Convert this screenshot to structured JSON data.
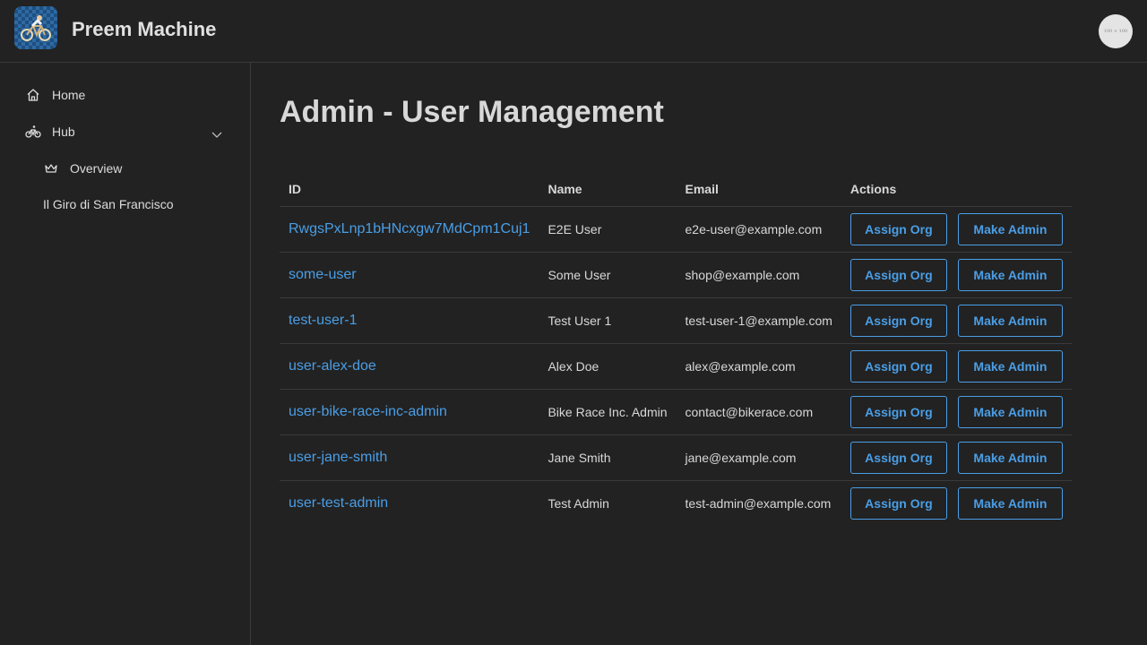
{
  "header": {
    "app_title": "Preem Machine",
    "avatar_text": "100 × 100"
  },
  "sidebar": {
    "items": [
      {
        "label": "Home",
        "icon": "home-icon"
      },
      {
        "label": "Hub",
        "icon": "bike-icon",
        "expanded": true
      },
      {
        "label": "Overview",
        "icon": "crown-icon"
      },
      {
        "label": "Il Giro di San Francisco"
      }
    ]
  },
  "main": {
    "title": "Admin - User Management",
    "table": {
      "columns": [
        "ID",
        "Name",
        "Email",
        "Actions"
      ],
      "assign_label": "Assign Org",
      "admin_label": "Make Admin",
      "rows": [
        {
          "id": "RwgsPxLnp1bHNcxgw7MdCpm1Cuj1",
          "name": "E2E User",
          "email": "e2e-user@example.com"
        },
        {
          "id": "some-user",
          "name": "Some User",
          "email": "shop@example.com"
        },
        {
          "id": "test-user-1",
          "name": "Test User 1",
          "email": "test-user-1@example.com"
        },
        {
          "id": "user-alex-doe",
          "name": "Alex Doe",
          "email": "alex@example.com"
        },
        {
          "id": "user-bike-race-inc-admin",
          "name": "Bike Race Inc. Admin",
          "email": "contact@bikerace.com"
        },
        {
          "id": "user-jane-smith",
          "name": "Jane Smith",
          "email": "jane@example.com"
        },
        {
          "id": "user-test-admin",
          "name": "Test Admin",
          "email": "test-admin@example.com"
        }
      ]
    }
  },
  "colors": {
    "background": "#222222",
    "accent": "#4a9ee6",
    "border": "#3a3a3a"
  }
}
